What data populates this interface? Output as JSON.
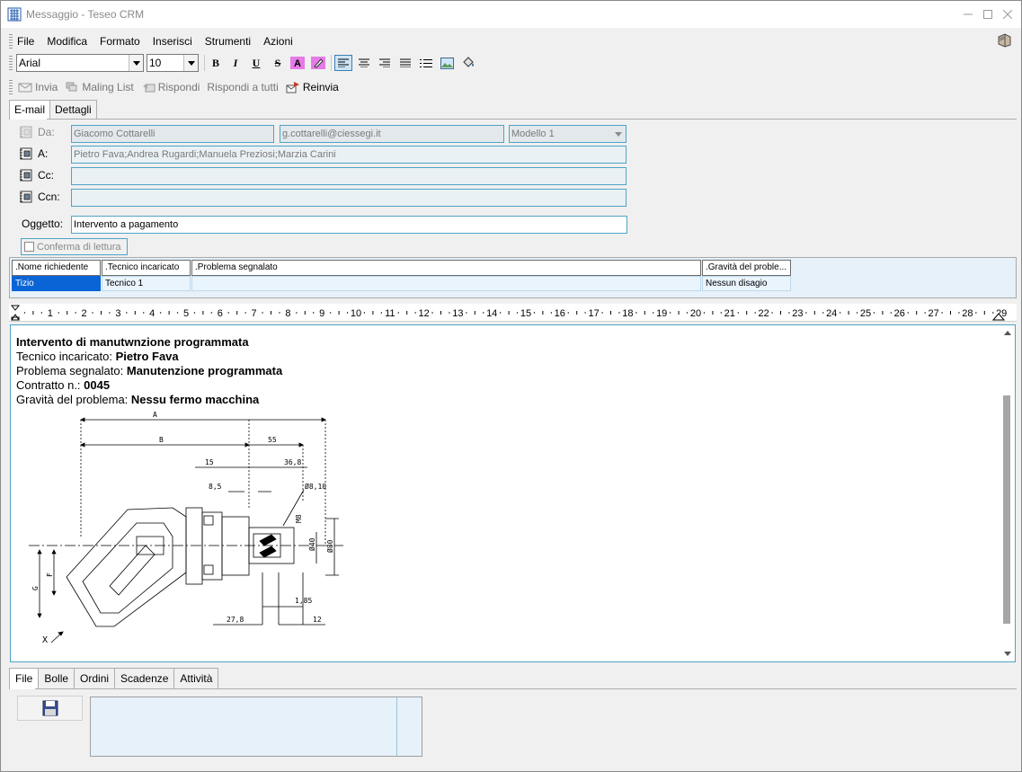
{
  "window": {
    "title": "Messaggio - Teseo CRM"
  },
  "menu": {
    "items": [
      {
        "label": "File",
        "key": "F"
      },
      {
        "label": "Modifica",
        "key": "M"
      },
      {
        "label": "Formato",
        "key": "o"
      },
      {
        "label": "Inserisci",
        "key": "I"
      },
      {
        "label": "Strumenti",
        "key": "S"
      },
      {
        "label": "Azioni",
        "key": "z"
      }
    ]
  },
  "format_toolbar": {
    "font": "Arial",
    "size": "10"
  },
  "actions": {
    "send": "Invia",
    "mailing_list": "Maling List",
    "reply": "Rispondi",
    "reply_all": "Rispondi a tutti",
    "forward": "Reinvia"
  },
  "tabs_top": [
    "E-mail",
    "Dettagli"
  ],
  "header": {
    "from_label": "Da:",
    "from_name": "Giacomo Cottarelli",
    "from_email": "g.cottarelli@ciessegi.it",
    "template": "Modello 1",
    "to_label": "A:",
    "to_value": "Pietro Fava;Andrea Rugardi;Manuela Preziosi;Marzia Carini",
    "cc_label": "Cc:",
    "cc_value": "",
    "bcc_label": "Ccn:",
    "bcc_value": "",
    "subject_label": "Oggetto:",
    "subject_value": "Intervento a pagamento",
    "read_receipt": "Conferma di lettura"
  },
  "grid": {
    "columns": [
      ".Nome richiedente",
      ".Tecnico incaricato",
      ".Problema segnalato",
      ".Gravità del proble..."
    ],
    "row": [
      "Tizio",
      "Tecnico 1",
      "",
      "Nessun disagio"
    ]
  },
  "ruler": {
    "numbers": [
      "1",
      "2",
      "3",
      "4",
      "5",
      "6",
      "7",
      "8",
      "9",
      "10",
      "11",
      "12",
      "13",
      "14",
      "15",
      "16",
      "17",
      "18",
      "19",
      "20",
      "21",
      "22",
      "23",
      "24",
      "25",
      "26",
      "27",
      "28",
      "29"
    ]
  },
  "body": {
    "title": "Intervento di manutwnzione programmata",
    "tech_label": "Tecnico incaricato: ",
    "tech_value": "Pietro Fava",
    "problem_label": "Problema segnalato: ",
    "problem_value": "Manutenzione programmata",
    "contract_label": "Contratto n.: ",
    "contract_value": "0045",
    "severity_label": "Gravità del problema: ",
    "severity_value": "Nessu fermo macchina"
  },
  "drawing": {
    "labels": [
      "A",
      "B",
      "55",
      "15",
      "36,8",
      "8,5",
      "Ø8,10",
      "Ø40",
      "Ø80",
      "M8",
      "G",
      "F",
      "1,85",
      "27,8",
      "12",
      "X"
    ]
  },
  "tabs_bottom": [
    "File",
    "Bolle",
    "Ordini",
    "Scadenze",
    "Attività"
  ]
}
